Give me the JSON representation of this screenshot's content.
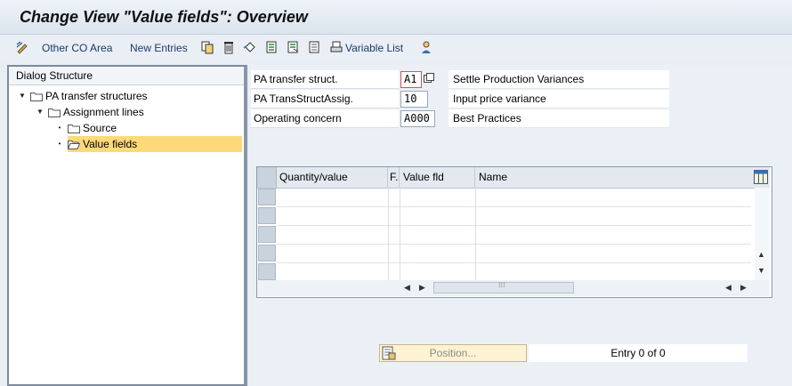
{
  "window": {
    "title": "Change View \"Value fields\": Overview"
  },
  "toolbar": {
    "other_co_area": "Other CO Area",
    "new_entries": "New Entries",
    "variable_list": "Variable List"
  },
  "dialog_structure": {
    "heading": "Dialog Structure",
    "items": [
      {
        "label": "PA transfer structures",
        "level": 0
      },
      {
        "label": "Assignment lines",
        "level": 1
      },
      {
        "label": "Source",
        "level": 2
      },
      {
        "label": "Value fields",
        "level": 2,
        "selected": true
      }
    ]
  },
  "header_fields": [
    {
      "label": "PA transfer struct.",
      "value": "A1",
      "description": "Settle Production Variances"
    },
    {
      "label": "PA TransStructAssig.",
      "value": "10",
      "description": "Input price variance"
    },
    {
      "label": "Operating concern",
      "value": "A000",
      "description": "Best Practices"
    }
  ],
  "table": {
    "columns": [
      "Quantity/value",
      "F.",
      "Value fld",
      "Name"
    ],
    "rows": []
  },
  "footer": {
    "position_button": "Position...",
    "entry_text": "Entry 0 of 0"
  },
  "colors": {
    "selection": "#fdd97a",
    "title_text": "#111111",
    "toolbar_text": "#1b3a6b"
  }
}
